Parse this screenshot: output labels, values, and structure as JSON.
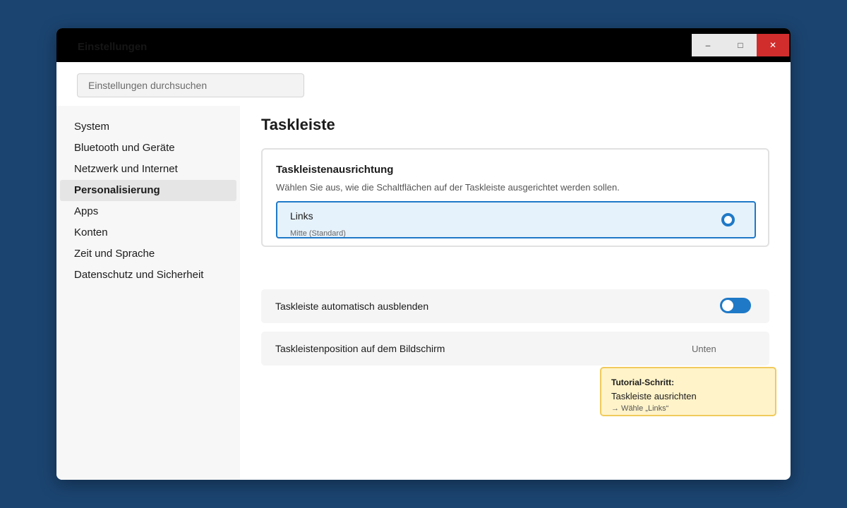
{
  "window": {
    "title": "Einstellungen",
    "controls": {
      "minimize": "–",
      "maximize": "□",
      "close": "✕"
    }
  },
  "search": {
    "placeholder": "Einstellungen durchsuchen"
  },
  "sidebar": {
    "items": [
      {
        "label": "System",
        "active": false
      },
      {
        "label": "Bluetooth und Geräte",
        "active": false
      },
      {
        "label": "Netzwerk und Internet",
        "active": false
      },
      {
        "label": "Personalisierung",
        "active": true
      },
      {
        "label": "Apps",
        "active": false
      },
      {
        "label": "Konten",
        "active": false
      },
      {
        "label": "Zeit und Sprache",
        "active": false
      },
      {
        "label": "Datenschutz und Sicherheit",
        "active": false
      }
    ]
  },
  "main": {
    "title": "Taskleiste",
    "alignment": {
      "title": "Taskleistenausrichtung",
      "description": "Wählen Sie aus, wie die Schaltflächen auf der Taskleiste ausgerichtet werden sollen.",
      "options": [
        "Links",
        "Mitte (Standard)"
      ],
      "selected": "Links"
    },
    "autohide": {
      "label": "Taskleiste automatisch ausblenden",
      "enabled": false
    },
    "position": {
      "label": "Taskleistenposition auf dem Bildschirm",
      "value": "Unten"
    }
  },
  "tutorial": {
    "heading": "Tutorial-Schritt:",
    "text": "Taskleiste ausrichten",
    "hint": "→ Wähle „Links“"
  },
  "colors": {
    "desktop": "#1b4470",
    "accent": "#1f79c7",
    "close_button": "#d12d2d",
    "tutorial_bg": "#fff3c9",
    "tutorial_border": "#f0ca5c",
    "selected_bg": "#e6f2fb"
  },
  "icons": {
    "minimize": "minimize-icon",
    "maximize": "maximize-icon",
    "close": "close-icon",
    "radio": "radio-selected-icon"
  }
}
